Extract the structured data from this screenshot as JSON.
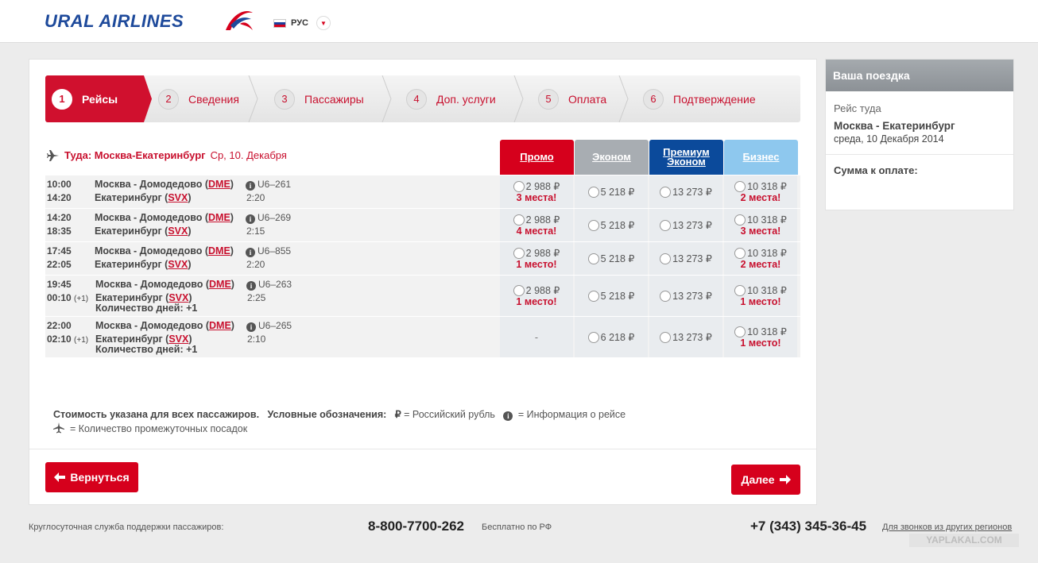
{
  "header": {
    "logo_text": "URAL AIRLINES",
    "lang_label": "РУС"
  },
  "steps": [
    {
      "num": "1",
      "label": "Рейсы"
    },
    {
      "num": "2",
      "label": "Сведения"
    },
    {
      "num": "3",
      "label": "Пассажиры"
    },
    {
      "num": "4",
      "label": "Доп. услуги"
    },
    {
      "num": "5",
      "label": "Оплата"
    },
    {
      "num": "6",
      "label": "Подтверждение"
    }
  ],
  "route": {
    "direction": "Туда: Москва-Екатеринбург",
    "date": "Ср, 10. Декабря"
  },
  "fare_classes": {
    "promo": "Промо",
    "econom": "Эконом",
    "premium_line1": "Премиум",
    "premium_line2": "Эконом",
    "business": "Бизнес"
  },
  "flights": [
    {
      "dep": "10:00",
      "arr": "14:20",
      "arr_plus": "",
      "from": "Москва - Домодедово (",
      "from_code": "DME",
      "to": "Екатеринбург (",
      "to_code": "SVX",
      "days": "",
      "flight": "U6–261",
      "duration": "2:20",
      "promo_price": "2 988 ₽",
      "promo_seats": "3 места!",
      "econom": "5 218 ₽",
      "premium": "13 273 ₽",
      "business": "10 318 ₽",
      "business_seats": "2 места!"
    },
    {
      "dep": "14:20",
      "arr": "18:35",
      "arr_plus": "",
      "from": "Москва - Домодедово (",
      "from_code": "DME",
      "to": "Екатеринбург (",
      "to_code": "SVX",
      "days": "",
      "flight": "U6–269",
      "duration": "2:15",
      "promo_price": "2 988 ₽",
      "promo_seats": "4 места!",
      "econom": "5 218 ₽",
      "premium": "13 273 ₽",
      "business": "10 318 ₽",
      "business_seats": "3 места!"
    },
    {
      "dep": "17:45",
      "arr": "22:05",
      "arr_plus": "",
      "from": "Москва - Домодедово (",
      "from_code": "DME",
      "to": "Екатеринбург (",
      "to_code": "SVX",
      "days": "",
      "flight": "U6–855",
      "duration": "2:20",
      "promo_price": "2 988 ₽",
      "promo_seats": "1 место!",
      "econom": "5 218 ₽",
      "premium": "13 273 ₽",
      "business": "10 318 ₽",
      "business_seats": "2 места!"
    },
    {
      "dep": "19:45",
      "arr": "00:10",
      "arr_plus": "(+1)",
      "from": "Москва - Домодедово (",
      "from_code": "DME",
      "to": "Екатеринбург (",
      "to_code": "SVX",
      "days": "Количество дней: +1",
      "flight": "U6–263",
      "duration": "2:25",
      "promo_price": "2 988 ₽",
      "promo_seats": "1 место!",
      "econom": "5 218 ₽",
      "premium": "13 273 ₽",
      "business": "10 318 ₽",
      "business_seats": "1 место!"
    },
    {
      "dep": "22:00",
      "arr": "02:10",
      "arr_plus": "(+1)",
      "from": "Москва - Домодедово (",
      "from_code": "DME",
      "to": "Екатеринбург (",
      "to_code": "SVX",
      "days": "Количество дней: +1",
      "flight": "U6–265",
      "duration": "2:10",
      "promo_price": "-",
      "promo_seats": "",
      "econom": "6 218 ₽",
      "premium": "13 273 ₽",
      "business": "10 318 ₽",
      "business_seats": "1 место!"
    }
  ],
  "legend": {
    "note": "Стоимость указана для всех пассажиров.",
    "legend_title": "Условные обозначения:",
    "rub_symbol": "₽",
    "rub_text": "= Российский рубль",
    "info_text": "= Информация о рейсе",
    "stops_text": "= Количество промежуточных посадок"
  },
  "buttons": {
    "back": "Вернуться",
    "next": "Далее"
  },
  "sidebar": {
    "title": "Ваша поездка",
    "leg_label": "Рейс туда",
    "route": "Москва - Екатеринбург",
    "date": "среда, 10 Декабря 2014",
    "sum_label": "Сумма к оплате:"
  },
  "footer": {
    "support": "Круглосуточная служба поддержки пассажиров:",
    "phone1": "8-800-7700-262",
    "phone1_note": "Бесплатно по РФ",
    "phone2": "+7 (343) 345-36-45",
    "phone2_note": "Для звонков из других регионов"
  },
  "watermark": "YAPLAKAL.COM",
  "colors": {
    "accent": "#d0102e",
    "promo": "#d6001c",
    "econom": "#a8adb2",
    "premium": "#0b4a9b",
    "business": "#8ec8ee"
  }
}
